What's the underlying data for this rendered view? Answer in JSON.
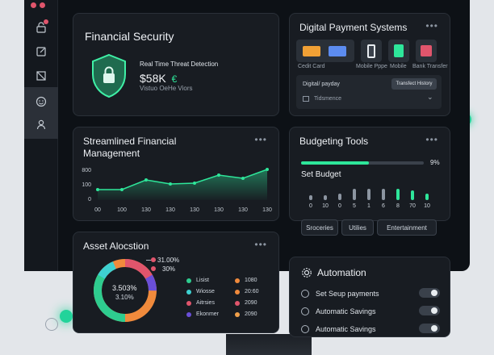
{
  "financial_security": {
    "title": "Financial Security",
    "line1": "Real Time Threat Detection",
    "amount": "$58K",
    "sub": "Vistuo OeHe Viors"
  },
  "payments": {
    "title": "Digital Payment Systems",
    "methods": [
      "Cedit Card",
      "Mobile Pppe",
      "Mobile",
      "Bank Transfer"
    ],
    "panel_label": "Digital/ payday",
    "panel_button": "Transfect History",
    "panel_row": "Tidsmence"
  },
  "trend": {
    "title": "Streamlined Financial Management"
  },
  "budget": {
    "title": "Budgeting Tools",
    "progress_pct": "9%",
    "progress_fraction": 0.55,
    "set_budget": "Set Budget",
    "bar_labels": [
      "0",
      "10",
      "0",
      "5",
      "1",
      "6",
      "8",
      "70",
      "10"
    ],
    "categories": [
      "Sroceries",
      "Utilies",
      "Entertainment"
    ]
  },
  "asset": {
    "title": "Asset Alocstion",
    "center_top": "3.503%",
    "center_bottom": "3.10%",
    "callout1": "31.00%",
    "callout2": "30%",
    "legend": [
      {
        "label": "Lisist",
        "color": "#2ecc8f"
      },
      {
        "label": "Wiosse",
        "color": "#3ed1d1"
      },
      {
        "label": "Aitrsies",
        "color": "#e0556c"
      },
      {
        "label": "Ekonmer",
        "color": "#6a4fd8"
      }
    ],
    "values": [
      {
        "label": "1080",
        "color": "#f08a3c"
      },
      {
        "label": "20:60",
        "color": "#f08a3c"
      },
      {
        "label": "2090",
        "color": "#e0556c"
      },
      {
        "label": "2090",
        "color": "#f0a04a"
      }
    ]
  },
  "automation": {
    "title": "Automation",
    "items": [
      "Set Seup payments",
      "Automatic Savings",
      "Automatic Savings"
    ]
  },
  "chart_data": {
    "type": "area",
    "x": [
      "00",
      "100",
      "130",
      "130",
      "130",
      "130",
      "130",
      "130"
    ],
    "y_ticks": [
      "800",
      "100",
      "0"
    ],
    "series": [
      {
        "values": [
          130,
          130,
          250,
          200,
          210,
          310,
          270,
          380
        ]
      }
    ],
    "ylim": [
      0,
      800
    ],
    "grid": false
  },
  "colors": {
    "accent": "#2ee69a",
    "background": "#0d1116",
    "card": "#181c22"
  }
}
